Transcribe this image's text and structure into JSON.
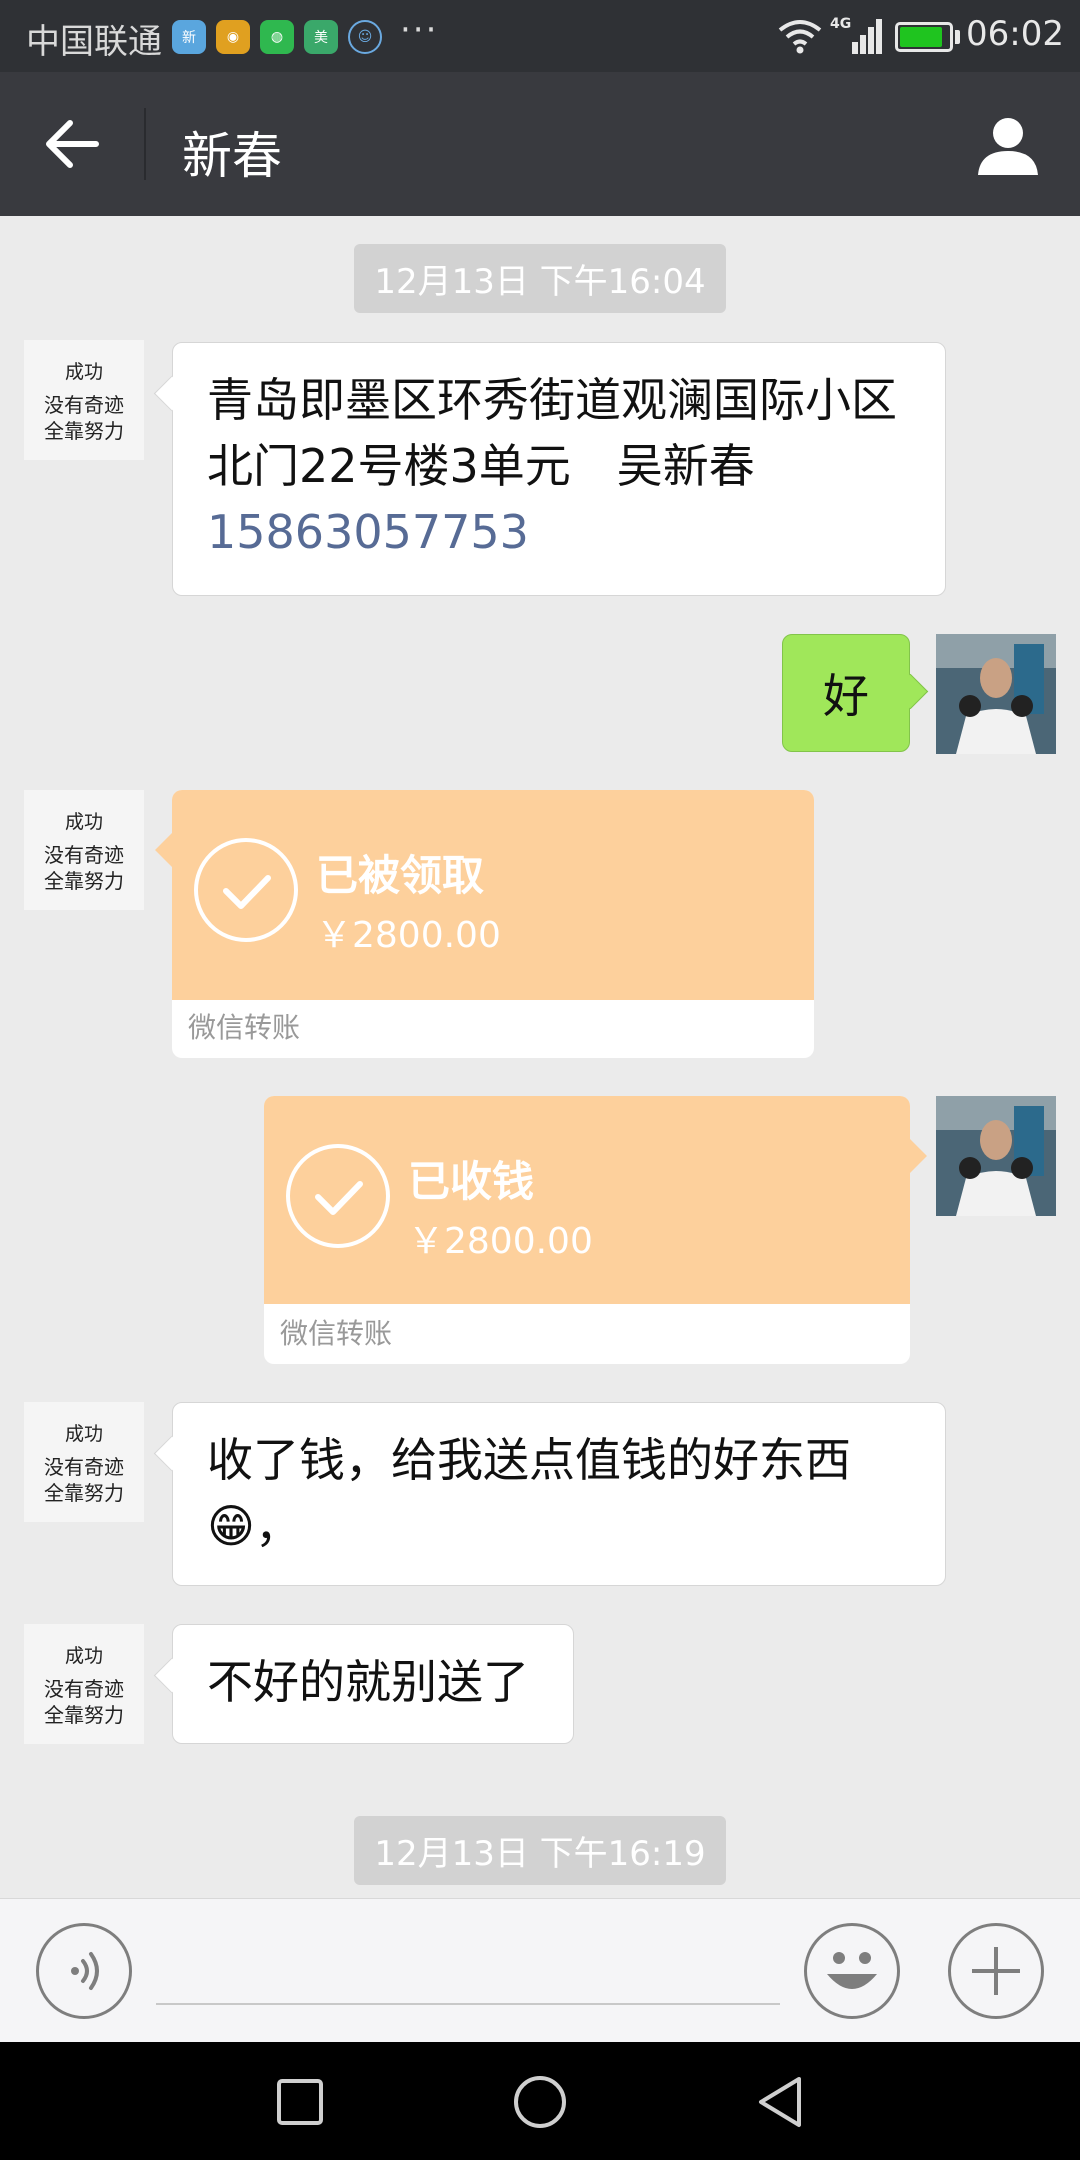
{
  "status_bar": {
    "carrier": "中国联通",
    "more": "···",
    "network": "4G",
    "time": "06:02"
  },
  "header": {
    "title": "新春"
  },
  "avatar_text": {
    "line1": "成功",
    "line2": "没有奇迹",
    "line3": "全靠努力"
  },
  "messages": {
    "ts1": "12月13日 下午16:04",
    "m1_text": "青岛即墨区环秀街道观澜国际小区北门22号楼3单元　吴新春 ",
    "m1_phone": "15863057753",
    "m2_text": "好",
    "t1_status": "已被领取",
    "t1_amount": "￥2800.00",
    "t1_footer": "微信转账",
    "t2_status": "已收钱",
    "t2_amount": "￥2800.00",
    "t2_footer": "微信转账",
    "m3_text": "收了钱，给我送点值钱的好东西😁，",
    "m4_text": "不好的就别送了",
    "ts2": "12月13日 下午16:19"
  },
  "colors": {
    "header_bg": "#393a3f",
    "chat_bg": "#ebebeb",
    "self_bubble": "#a0e75a",
    "transfer": "#fdd09c",
    "link": "#576b95"
  }
}
